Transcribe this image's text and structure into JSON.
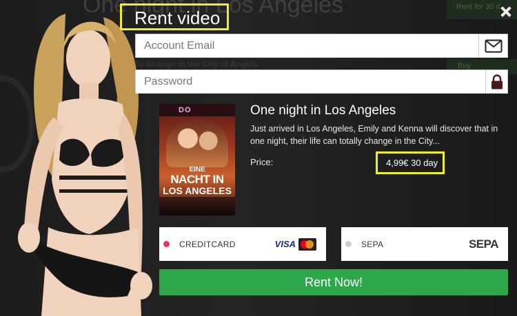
{
  "background": {
    "title": "One night in Los Angeles",
    "subtitle": "can totally change in the City of Angels.",
    "rent_button": "Rent for 30 d",
    "buy_button": "Buy"
  },
  "modal": {
    "title": "Rent video",
    "email_placeholder": "Account Email",
    "password_placeholder": "Password",
    "email_icon": "envelope-icon",
    "password_icon": "lock-icon",
    "close_icon": "close-icon"
  },
  "video": {
    "title": "One night in Los Angeles",
    "description": "Just arrived in Los Angeles, Emily and Kenna will discover that in one night, their life can totally change in the City...",
    "price_label": "Price:",
    "price_value": "4,99€ 30 day",
    "poster": {
      "studio": "DO",
      "line1": "EINE",
      "line2": "NACHT IN",
      "line3": "LOS ANGELES"
    }
  },
  "payment": {
    "methods": [
      {
        "label": "CREDITCARD",
        "logo": "VISA",
        "selected": true,
        "dot_color": "#e8345c"
      },
      {
        "label": "SEPA",
        "logo": "SEPA",
        "selected": false,
        "dot_color": "#cccccc"
      }
    ]
  },
  "actions": {
    "rent_now": "Rent Now!"
  },
  "colors": {
    "highlight": "#f2ef1c",
    "primary_button": "#2ea84a"
  }
}
